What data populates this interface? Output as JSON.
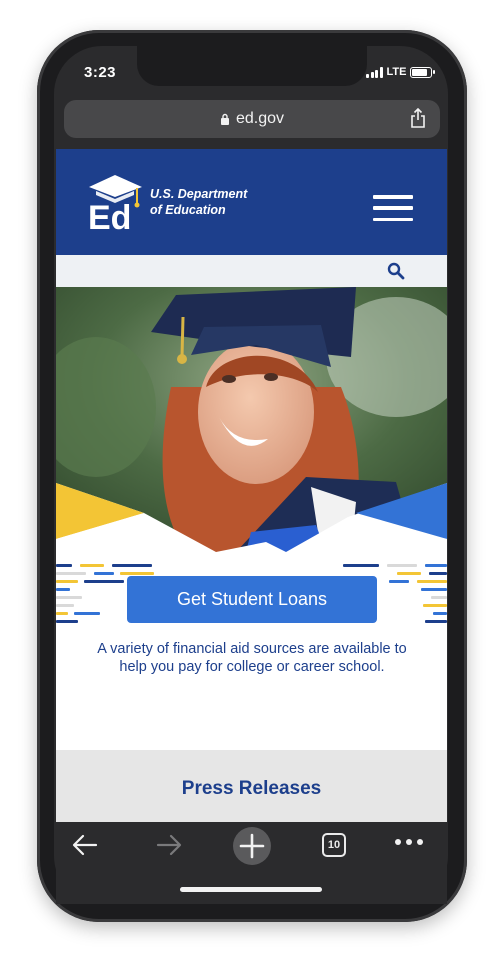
{
  "status_bar": {
    "time": "3:23",
    "network": "LTE"
  },
  "browser": {
    "url": "ed.gov",
    "tab_count": "10"
  },
  "site": {
    "logo_line1": "U.S. Department",
    "logo_line2": "of Education",
    "logo_mark": "Ed"
  },
  "hero": {
    "cta_label": "Get Student Loans",
    "cta_text": "A variety of financial aid sources are available to help you pay for college or career school."
  },
  "press": {
    "title": "Press Releases"
  },
  "colors": {
    "brand_navy": "#1d3f8c",
    "cta_blue": "#3373d6",
    "accent_yellow": "#f3c535"
  },
  "icons": [
    "lock-icon",
    "share-icon",
    "menu-icon",
    "search-icon",
    "back-icon",
    "forward-icon",
    "new-tab-icon",
    "tabs-icon",
    "more-icon"
  ]
}
